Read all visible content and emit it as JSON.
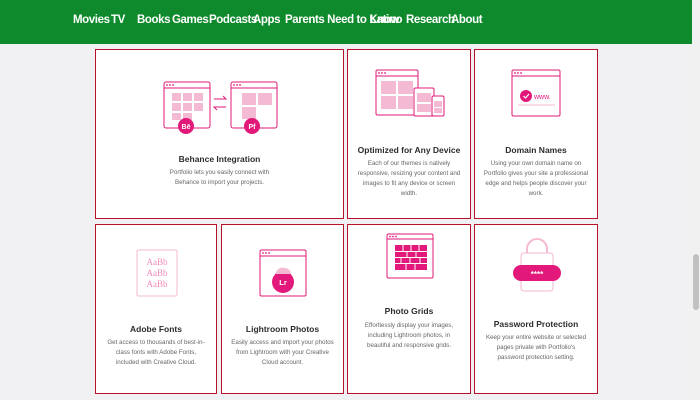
{
  "nav": {
    "items": [
      "Movies",
      "TV",
      "Books",
      "Games",
      "Podcasts",
      "Apps",
      "Parents Need to Know",
      "Latino",
      "Research",
      "About"
    ]
  },
  "features": {
    "behance": {
      "title": "Behance Integration",
      "desc": "Portfolio lets you easily connect with Behance to import your projects.",
      "badge_left": "Bē",
      "badge_right": "Pf"
    },
    "device": {
      "title": "Optimized for Any Device",
      "desc": "Each of our themes is natively responsive, resizing your content and images to fit any device or screen width."
    },
    "domain": {
      "title": "Domain Names",
      "desc": "Using your own domain name on Portfolio gives your site a professional edge and helps people discover your work.",
      "url_text": "www."
    },
    "fonts": {
      "title": "Adobe Fonts",
      "desc": "Get access to thousands of best-in-class fonts with Adobe Fonts, included with Creative Cloud.",
      "sample_lines": [
        "AaBb",
        "AaBb",
        "AaBb"
      ]
    },
    "lightroom": {
      "title": "Lightroom Photos",
      "desc": "Easily access and import your photos from Lightroom with your Creative Cloud account.",
      "badge": "Lr"
    },
    "grids": {
      "title": "Photo Grids",
      "desc": "Effortlessly display your images, including Lightroom photos, in beautiful and responsive grids."
    },
    "password": {
      "title": "Password Protection",
      "desc": "Keep your entire website or selected pages private with Portfolio's password protection setting.",
      "mask": "****"
    }
  },
  "colors": {
    "nav_bg": "#0e8a2c",
    "card_border": "#b8112b",
    "icon_accent": "#e2197a"
  }
}
